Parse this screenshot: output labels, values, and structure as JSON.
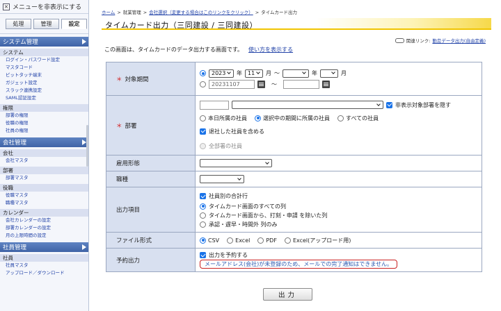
{
  "sidebar": {
    "toggle_label": "メニューを非表示にする",
    "tabs": [
      "処理",
      "管理",
      "設定"
    ],
    "sections": [
      {
        "title": "システム管理",
        "groups": [
          {
            "title": "システム",
            "links": [
              "ログイン・パスワード設定",
              "マスタコード",
              "ピットタッチ端末",
              "ガジェット設定",
              "スラック連携設定",
              "SAML認証設定"
            ]
          },
          {
            "title": "権限",
            "links": [
              "部署の権限",
              "役職の権限",
              "社員の権限"
            ]
          }
        ]
      },
      {
        "title": "会社管理",
        "groups": [
          {
            "title": "会社",
            "links": [
              "会社マスタ"
            ]
          },
          {
            "title": "部署",
            "links": [
              "部署マスタ"
            ]
          },
          {
            "title": "役職",
            "links": [
              "役職マスタ",
              "職種マスタ"
            ]
          },
          {
            "title": "カレンダー",
            "links": [
              "会社カレンダーの設定",
              "部署カレンダーの設定",
              "月の上限時間の設定"
            ]
          }
        ]
      },
      {
        "title": "社員管理",
        "groups": [
          {
            "title": "社員",
            "links": [
              "社員マスタ",
              "アップロード／ダウンロード"
            ]
          }
        ]
      }
    ]
  },
  "breadcrumb": {
    "home": "ホーム",
    "sep": ">",
    "item2": "就業管理",
    "item3": "会社選択（変更する場合はこのリンクをクリック）",
    "current": "タイムカード出力"
  },
  "page_title": "タイムカード出力（三同建設 / 三同建設）",
  "related": {
    "label": "関連リンク:",
    "link": "勤怠データ出力(自由定義)"
  },
  "intro": {
    "text": "この画面は、タイムカードのデータ出力する画面です。",
    "help_link": "使い方を表示する"
  },
  "form": {
    "period": {
      "label": "対象期間",
      "required_mark": "＊",
      "year_value": "2023",
      "year_unit": "年",
      "month_value": "11",
      "month_unit": "月",
      "tilde": "〜",
      "to_year_unit": "年",
      "to_month_unit": "月",
      "date_value": "20231107"
    },
    "dept": {
      "label": "部署",
      "required_mark": "＊",
      "hide_label": "非表示対象部署を隠す",
      "radio1": "本日所属の社員",
      "radio2": "選択中の期間に所属の社員",
      "radio3": "すべての社員",
      "retired": "退社した社員を含める",
      "all_dept": "全部署の社員"
    },
    "employment": {
      "label": "雇用形態"
    },
    "job": {
      "label": "職種"
    },
    "output_items": {
      "label": "出力項目",
      "cb": "社員別の合計行",
      "r1": "タイムカード画面のすべての列",
      "r2": "タイムカード画面から、打刻・申請 を除いた列",
      "r3": "承認・遅早・時間外 列のみ"
    },
    "file_format": {
      "label": "ファイル形式",
      "options": [
        "CSV",
        "Excel",
        "PDF",
        "Excel(アップロード用)"
      ]
    },
    "reserve": {
      "label": "予約出力",
      "cb": "出力を予約する",
      "warning": "メールアドレス(会社)が未登録のため、メールでの完了通知はできません。"
    }
  },
  "output_button": "出力"
}
